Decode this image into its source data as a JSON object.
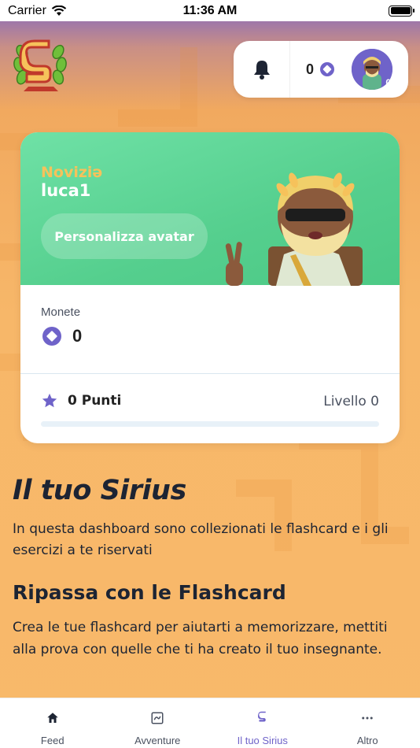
{
  "status_bar": {
    "carrier": "Carrier",
    "time": "11:36 AM"
  },
  "header": {
    "coins": "0",
    "avatar_badge": "0"
  },
  "profile": {
    "rank": "Noviziə",
    "username": "luca1",
    "customize_label": "Personalizza avatar",
    "coins_label": "Monete",
    "coins_value": "0",
    "points_label": "0 Punti",
    "level_label": "Livello 0",
    "level_progress": 0
  },
  "content": {
    "title": "Il tuo Sirius",
    "description": "In questa dashboard sono collezionati le flashcard e i gli esercizi a te riservati",
    "flashcard_title": "Ripassa con le Flashcard",
    "flashcard_description": "Crea le tue flashcard per aiutarti a memorizzare, mettiti alla prova con quelle che ti ha creato il tuo insegnante."
  },
  "tabs": [
    {
      "label": "Feed",
      "icon": "home-icon"
    },
    {
      "label": "Avventure",
      "icon": "map-icon"
    },
    {
      "label": "Il tuo Sirius",
      "icon": "sirius-logo-icon",
      "active": true
    },
    {
      "label": "Altro",
      "icon": "more-icon"
    }
  ],
  "colors": {
    "accent": "#6f63c9",
    "card_green": "#55cf8e",
    "rank_gold": "#f6c25b",
    "background": "#f7b65e"
  }
}
